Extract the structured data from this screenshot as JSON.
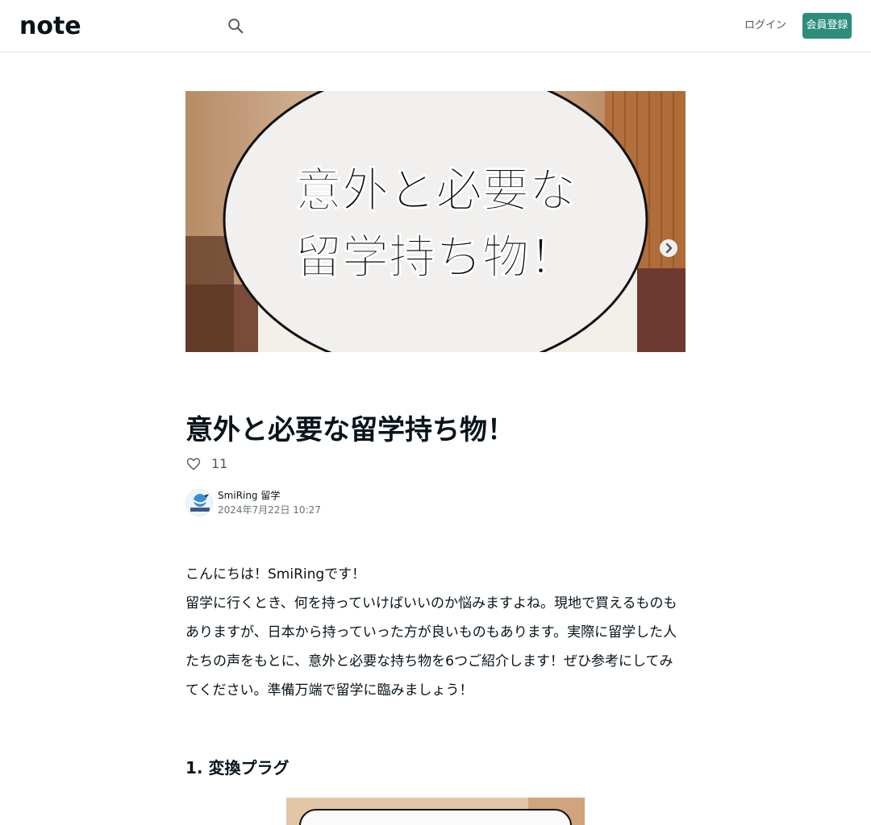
{
  "header": {
    "logo_text": "note",
    "search_icon": "search-icon",
    "login_label": "ログイン",
    "signup_label": "会員登録",
    "signup_color": "#2d8d7a"
  },
  "hero": {
    "line1": "意外と必要な",
    "line2": "留学持ち物！",
    "next_icon": "chevron-right-icon"
  },
  "article": {
    "title": "意外と必要な留学持ち物！",
    "like_icon": "heart-icon",
    "like_count": "11",
    "author_name": "SmiRing 留学",
    "date": "2024年7月22日 10:27",
    "paragraphs": [
      "こんにちは！SmiRingです！",
      "留学に行くとき、何を持っていけばいいのか悩みますよね。現地で買えるものもありますが、日本から持っていった方が良いものもあります。実際に留学した人たちの声をもとに、意外と必要な持ち物を6つご紹介します！ぜひ参考にしてみてください。準備万端で留学に臨みましょう！"
    ],
    "section_heading": "1. 変換プラグ"
  }
}
